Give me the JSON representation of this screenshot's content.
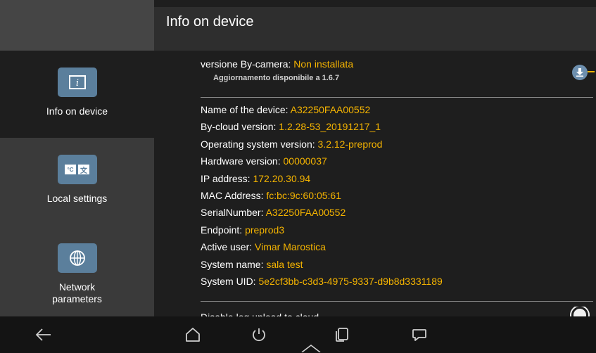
{
  "header": {
    "title": "Info on device"
  },
  "sidebar": {
    "items": [
      {
        "label": "Info on device",
        "icon": "info-icon",
        "active": true
      },
      {
        "label": "Local settings",
        "icon": "language-icon",
        "active": false
      },
      {
        "label": "Network parameters",
        "icon": "globe-icon",
        "active": false
      }
    ],
    "language_tile": {
      "unit": "°C",
      "glyph": "文"
    },
    "info_glyph": "i"
  },
  "update": {
    "label": "versione By-camera: ",
    "value": "Non installata",
    "notice": "Aggiornamento disponibile a 1.6.7",
    "icon": "download-icon"
  },
  "info": [
    {
      "label": "Name of the device: ",
      "value": "A32250FAA00552"
    },
    {
      "label": "By-cloud version: ",
      "value": "1.2.28-53_20191217_1"
    },
    {
      "label": "Operating system version: ",
      "value": "3.2.12-preprod"
    },
    {
      "label": "Hardware version: ",
      "value": "00000037"
    },
    {
      "label": "IP address: ",
      "value": "172.20.30.94"
    },
    {
      "label": "MAC Address: ",
      "value": "fc:bc:9c:60:05:61"
    },
    {
      "label": "SerialNumber: ",
      "value": "A32250FAA00552"
    },
    {
      "label": "Endpoint: ",
      "value": "preprod3"
    },
    {
      "label": "Active user: ",
      "value": "Vimar Marostica"
    },
    {
      "label": "System name: ",
      "value": "sala test"
    },
    {
      "label": "System UID: ",
      "value": "5e2cf3bb-c3d3-4975-9337-d9b8d3331189"
    }
  ],
  "log_option": {
    "label": "Disable log upload to cloud"
  },
  "navbar": {
    "items": [
      "back-icon",
      "home-icon",
      "power-icon",
      "recents-icon",
      "chat-icon"
    ]
  },
  "colors": {
    "accent": "#f5b400",
    "tile": "#5b7f9c"
  }
}
